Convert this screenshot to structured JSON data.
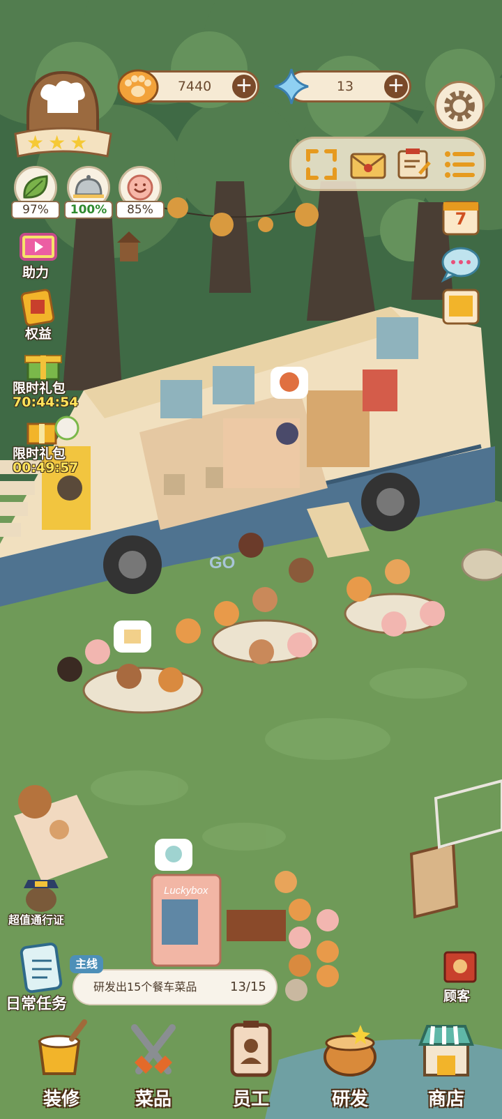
{
  "resources": {
    "paw_coins": "7440",
    "gems": "13"
  },
  "stats": [
    {
      "icon": "leaf-icon",
      "value": "97%"
    },
    {
      "icon": "cloche-icon",
      "value": "100%"
    },
    {
      "icon": "smile-face-icon",
      "value": "85%"
    }
  ],
  "side_menu": {
    "assist_label": "助力",
    "benefits_label": "权益",
    "gift1_label": "限时礼包",
    "gift1_timer": "70:44:54",
    "gift2_label": "限时礼包",
    "gift2_timer": "00:49:57",
    "pass_label": "超值通行证",
    "daily_tasks_label": "日常任务"
  },
  "right_menu": {
    "calendar_day": "7",
    "customers_label": "顾客"
  },
  "quest": {
    "tag": "主线",
    "text": "研发出15个餐车菜品",
    "progress": "13/15"
  },
  "vending_sign": "Luckybox",
  "bus_sign": "GO",
  "bottom_nav": [
    {
      "label": "装修",
      "icon": "paint-bucket-icon"
    },
    {
      "label": "菜品",
      "icon": "fork-spoon-icon"
    },
    {
      "label": "员工",
      "icon": "staff-badge-icon"
    },
    {
      "label": "研发",
      "icon": "cooking-pot-icon"
    },
    {
      "label": "商店",
      "icon": "shop-icon"
    }
  ],
  "colors": {
    "accent_brown": "#7a4a2a",
    "panel_cream": "#f6ead4",
    "grass": "#6f9a58",
    "timer_yellow": "#ffe35a"
  }
}
